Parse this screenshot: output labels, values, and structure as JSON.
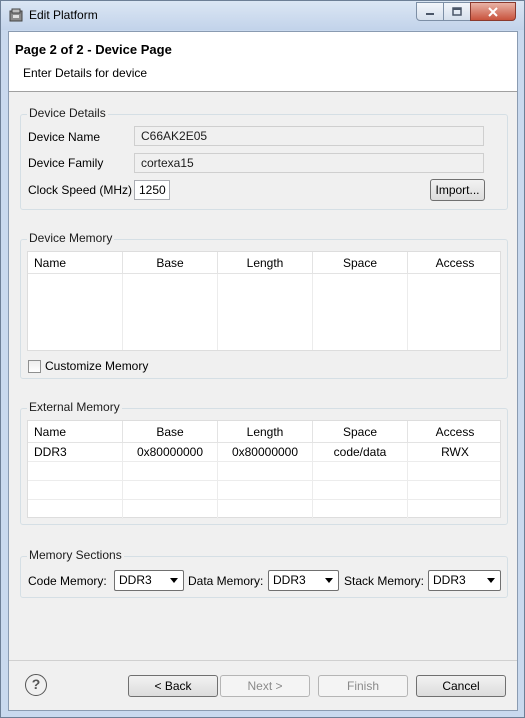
{
  "window": {
    "title": "Edit Platform"
  },
  "banner": {
    "title": "Page 2 of 2 - Device Page",
    "subtitle": "Enter Details for device"
  },
  "device_details": {
    "label": "Device Details",
    "device_name_label": "Device Name",
    "device_name_value": "C66AK2E05",
    "device_family_label": "Device Family",
    "device_family_value": "cortexa15",
    "clock_speed_label": "Clock Speed (MHz)",
    "clock_speed_value": "1250",
    "import_button": "Import..."
  },
  "device_memory": {
    "label": "Device Memory",
    "columns": [
      "Name",
      "Base",
      "Length",
      "Space",
      "Access"
    ],
    "customize_label": "Customize Memory",
    "customize_checked": false
  },
  "external_memory": {
    "label": "External Memory",
    "columns": [
      "Name",
      "Base",
      "Length",
      "Space",
      "Access"
    ],
    "rows": [
      [
        "DDR3",
        "0x80000000",
        "0x80000000",
        "code/data",
        "RWX"
      ]
    ]
  },
  "memory_sections": {
    "label": "Memory Sections",
    "code_memory_label": "Code Memory:",
    "code_memory_value": "DDR3",
    "data_memory_label": "Data Memory:",
    "data_memory_value": "DDR3",
    "stack_memory_label": "Stack Memory:",
    "stack_memory_value": "DDR3"
  },
  "buttons": {
    "back": "< Back",
    "next": "Next >",
    "finish": "Finish",
    "cancel": "Cancel"
  },
  "icons": {
    "help": "help-icon",
    "app": "app-icon"
  }
}
